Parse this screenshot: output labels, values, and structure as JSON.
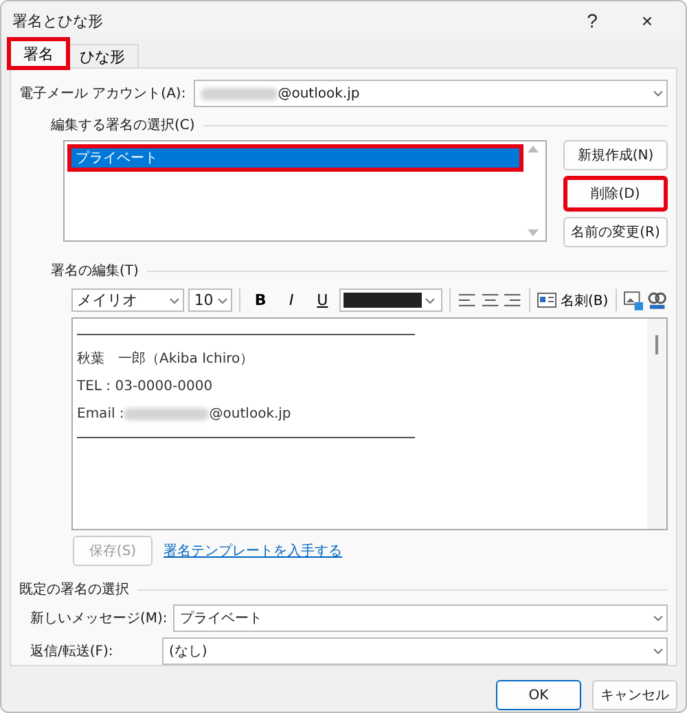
{
  "window": {
    "title": "署名とひな形",
    "help": "?",
    "close": "×"
  },
  "tabs": [
    {
      "label": "署名",
      "selected": true,
      "highlighted": true
    },
    {
      "label": "ひな形",
      "selected": false,
      "highlighted": false
    }
  ],
  "account": {
    "label": "電子メール アカウント(A):",
    "value": "@outlook.jp"
  },
  "select_section": {
    "title": "編集する署名の選択(C)",
    "items": [
      {
        "label": "プライベート",
        "selected": true,
        "highlighted": true
      }
    ],
    "buttons": [
      {
        "label": "新規作成(N)",
        "highlighted": false
      },
      {
        "label": "削除(D)",
        "highlighted": true
      },
      {
        "label": "名前の変更(R)",
        "highlighted": false
      }
    ]
  },
  "edit_section": {
    "title": "署名の編集(T)",
    "font": "メイリオ",
    "size": "10",
    "bold": "B",
    "italic": "I",
    "underline": "U",
    "color": "#222222",
    "card_button": "名刺(B)",
    "lines": [
      {
        "kind": "rule"
      },
      {
        "kind": "text",
        "text": "秋葉　一郎（Akiba Ichiro）"
      },
      {
        "kind": "text",
        "text": "TEL : 03-0000-0000"
      },
      {
        "kind": "email",
        "prefix": "Email : ",
        "text": "@outlook.jp"
      },
      {
        "kind": "rule"
      }
    ],
    "save_button": {
      "label": "保存(S)",
      "disabled": true
    },
    "template_link": "署名テンプレートを入手する"
  },
  "default_section": {
    "title": "既定の署名の選択",
    "rows": [
      {
        "label": "新しいメッセージ(M):",
        "value": "プライベート"
      },
      {
        "label": "返信/転送(F):",
        "value": "(なし)"
      }
    ]
  },
  "buttons": [
    {
      "label": "OK",
      "default": true
    },
    {
      "label": "キャンセル",
      "default": false
    }
  ]
}
